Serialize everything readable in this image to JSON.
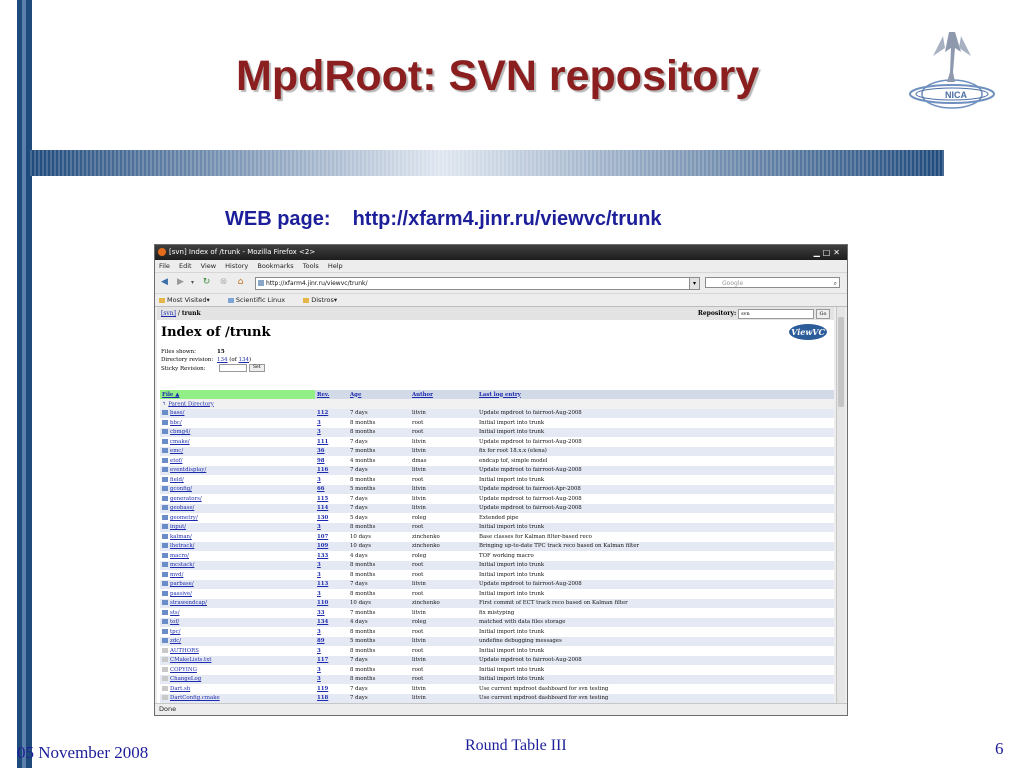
{
  "slide": {
    "title": "MpdRoot: SVN repository",
    "web_label": "WEB page:",
    "web_url": "http://xfarm4.jinr.ru/viewvc/trunk",
    "footer_date": "05 November 2008",
    "footer_center": "Round Table III",
    "slide_number": "6",
    "colors": {
      "title": "#8b1e1e",
      "accent_text": "#1d1f9a",
      "bar": "#1f4a7c"
    }
  },
  "browser": {
    "title": "[svn] Index of /trunk - Mozilla Firefox <2>",
    "menu": [
      "File",
      "Edit",
      "View",
      "History",
      "Bookmarks",
      "Tools",
      "Help"
    ],
    "url": "http://xfarm4.jinr.ru/viewvc/trunk/",
    "search_placeholder": "Google",
    "bookmarks": [
      "Most Visited▾",
      "Scientific Linux",
      "Distros▾"
    ],
    "status": "Done"
  },
  "viewvc": {
    "breadcrumb_root": "[svn]",
    "breadcrumb_sep": " / ",
    "breadcrumb_current": "trunk",
    "repository_label": "Repository:",
    "repository_value": "svn",
    "go_label": "Go",
    "heading": "Index of /trunk",
    "logo_text": "ViewVC",
    "files_shown_label": "Files shown:",
    "files_shown_value": "15",
    "dir_rev_label": "Directory revision:",
    "dir_rev_value": "134",
    "dir_rev_of": "(of",
    "dir_rev_total": "134",
    "dir_rev_close": ")",
    "sticky_label": "Sticky Revision:",
    "set_label": "Set",
    "columns": [
      "File ▲",
      "Rev.",
      "Age",
      "Author",
      "Last log entry"
    ],
    "parent_directory": "Parent Directory",
    "rows": [
      {
        "name": "base/",
        "rev": "112",
        "age": "7 days",
        "author": "litvin",
        "log": "Update mpdroot to fairroot-Aug-2008",
        "type": "dir"
      },
      {
        "name": "bbc/",
        "rev": "3",
        "age": "8 months",
        "author": "root",
        "log": "Initial import into trunk",
        "type": "dir"
      },
      {
        "name": "cbmg4/",
        "rev": "3",
        "age": "8 months",
        "author": "root",
        "log": "Initial import into trunk",
        "type": "dir"
      },
      {
        "name": "cmake/",
        "rev": "111",
        "age": "7 days",
        "author": "litvin",
        "log": "Update mpdroot to fairroot-Aug-2008",
        "type": "dir"
      },
      {
        "name": "emc/",
        "rev": "36",
        "age": "7 months",
        "author": "litvin",
        "log": "fix for root 18.x.x (elena)",
        "type": "dir"
      },
      {
        "name": "etof/",
        "rev": "98",
        "age": "4 months",
        "author": "dmas",
        "log": "endcap tof, simple model",
        "type": "dir"
      },
      {
        "name": "eventdisplay/",
        "rev": "116",
        "age": "7 days",
        "author": "litvin",
        "log": "Update mpdroot to fairroot-Aug-2008",
        "type": "dir"
      },
      {
        "name": "field/",
        "rev": "3",
        "age": "8 months",
        "author": "root",
        "log": "Initial import into trunk",
        "type": "dir"
      },
      {
        "name": "gconfig/",
        "rev": "66",
        "age": "5 months",
        "author": "litvin",
        "log": "Update mpdroot to fairroot-Apr-2008",
        "type": "dir"
      },
      {
        "name": "generators/",
        "rev": "115",
        "age": "7 days",
        "author": "litvin",
        "log": "Update mpdroot to fairroot-Aug-2008",
        "type": "dir"
      },
      {
        "name": "geobase/",
        "rev": "114",
        "age": "7 days",
        "author": "litvin",
        "log": "Update mpdroot to fairroot-Aug-2008",
        "type": "dir"
      },
      {
        "name": "geometry/",
        "rev": "130",
        "age": "5 days",
        "author": "roleg",
        "log": "Extended pipe",
        "type": "dir"
      },
      {
        "name": "input/",
        "rev": "3",
        "age": "8 months",
        "author": "root",
        "log": "Initial import into trunk",
        "type": "dir"
      },
      {
        "name": "kalman/",
        "rev": "107",
        "age": "10 days",
        "author": "zinchenko",
        "log": "Base classes for Kalman filter-based reco",
        "type": "dir"
      },
      {
        "name": "lhetrack/",
        "rev": "109",
        "age": "10 days",
        "author": "zinchenko",
        "log": "Bringing up-to-date TPC track reco based on Kalman filter",
        "type": "dir"
      },
      {
        "name": "macro/",
        "rev": "133",
        "age": "4 days",
        "author": "roleg",
        "log": "TOF working macro",
        "type": "dir"
      },
      {
        "name": "mcstack/",
        "rev": "3",
        "age": "8 months",
        "author": "root",
        "log": "Initial import into trunk",
        "type": "dir"
      },
      {
        "name": "mvd/",
        "rev": "3",
        "age": "8 months",
        "author": "root",
        "log": "Initial import into trunk",
        "type": "dir"
      },
      {
        "name": "parbase/",
        "rev": "113",
        "age": "7 days",
        "author": "litvin",
        "log": "Update mpdroot to fairroot-Aug-2008",
        "type": "dir"
      },
      {
        "name": "passive/",
        "rev": "3",
        "age": "8 months",
        "author": "root",
        "log": "Initial import into trunk",
        "type": "dir"
      },
      {
        "name": "strawendcap/",
        "rev": "110",
        "age": "10 days",
        "author": "zinchenko",
        "log": "First commit of ECT track reco based on Kalman filter",
        "type": "dir"
      },
      {
        "name": "sts/",
        "rev": "33",
        "age": "7 months",
        "author": "litvin",
        "log": "fix mistyping",
        "type": "dir"
      },
      {
        "name": "tof/",
        "rev": "134",
        "age": "4 days",
        "author": "roleg",
        "log": "matched with data files storage",
        "type": "dir"
      },
      {
        "name": "tpc/",
        "rev": "3",
        "age": "8 months",
        "author": "root",
        "log": "Initial import into trunk",
        "type": "dir"
      },
      {
        "name": "zdc/",
        "rev": "89",
        "age": "5 months",
        "author": "litvin",
        "log": "undefine debugging messages",
        "type": "dir"
      },
      {
        "name": "AUTHORS",
        "rev": "3",
        "age": "8 months",
        "author": "root",
        "log": "Initial import into trunk",
        "type": "file"
      },
      {
        "name": "CMakeLists.txt",
        "rev": "117",
        "age": "7 days",
        "author": "litvin",
        "log": "Update mpdroot to fairroot-Aug-2008",
        "type": "file"
      },
      {
        "name": "COPYING",
        "rev": "3",
        "age": "8 months",
        "author": "root",
        "log": "Initial import into trunk",
        "type": "file"
      },
      {
        "name": "ChangeLog",
        "rev": "3",
        "age": "8 months",
        "author": "root",
        "log": "Initial import into trunk",
        "type": "file"
      },
      {
        "name": "Dart.sh",
        "rev": "119",
        "age": "7 days",
        "author": "litvin",
        "log": "Use current mpdroot dashboard for svn testing",
        "type": "file"
      },
      {
        "name": "DartConfig.cmake",
        "rev": "118",
        "age": "7 days",
        "author": "litvin",
        "log": "Use current mpdroot dashboard for svn testing",
        "type": "file"
      }
    ]
  }
}
